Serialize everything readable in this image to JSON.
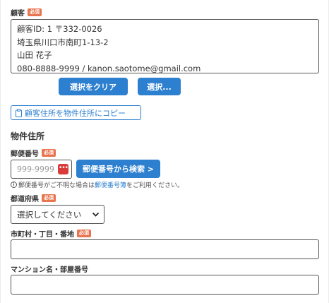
{
  "customer": {
    "label": "顧客",
    "required": "必須",
    "lines": [
      "顧客ID: 1 〒332-0026",
      "埼玉県川口市南町1-13-2",
      "山田 花子",
      "080-8888-9999 / kanon.saotome@gmail.com"
    ],
    "clear_button": "選択をクリア",
    "select_button": "選択..."
  },
  "copy_button": "顧客住所を物件住所にコピー",
  "property": {
    "section_title": "物件住所",
    "postal": {
      "label": "郵便番号",
      "required": "必須",
      "placeholder": "999-9999",
      "search_button": "郵便番号から検索 >",
      "note_before": "郵便番号がご不明な場合は",
      "note_link": "郵便番号簿",
      "note_after": "をご利用ください。"
    },
    "prefecture": {
      "label": "都道府県",
      "required": "必須",
      "selected": "選択してください"
    },
    "city": {
      "label": "市町村・丁目・番地",
      "required": "必須",
      "value": ""
    },
    "building": {
      "label": "マンション名・部屋番号",
      "value": ""
    }
  },
  "colors": {
    "primary": "#2d7fcf",
    "required_badge": "#e8744f",
    "autofill_icon": "#d93a3a"
  }
}
